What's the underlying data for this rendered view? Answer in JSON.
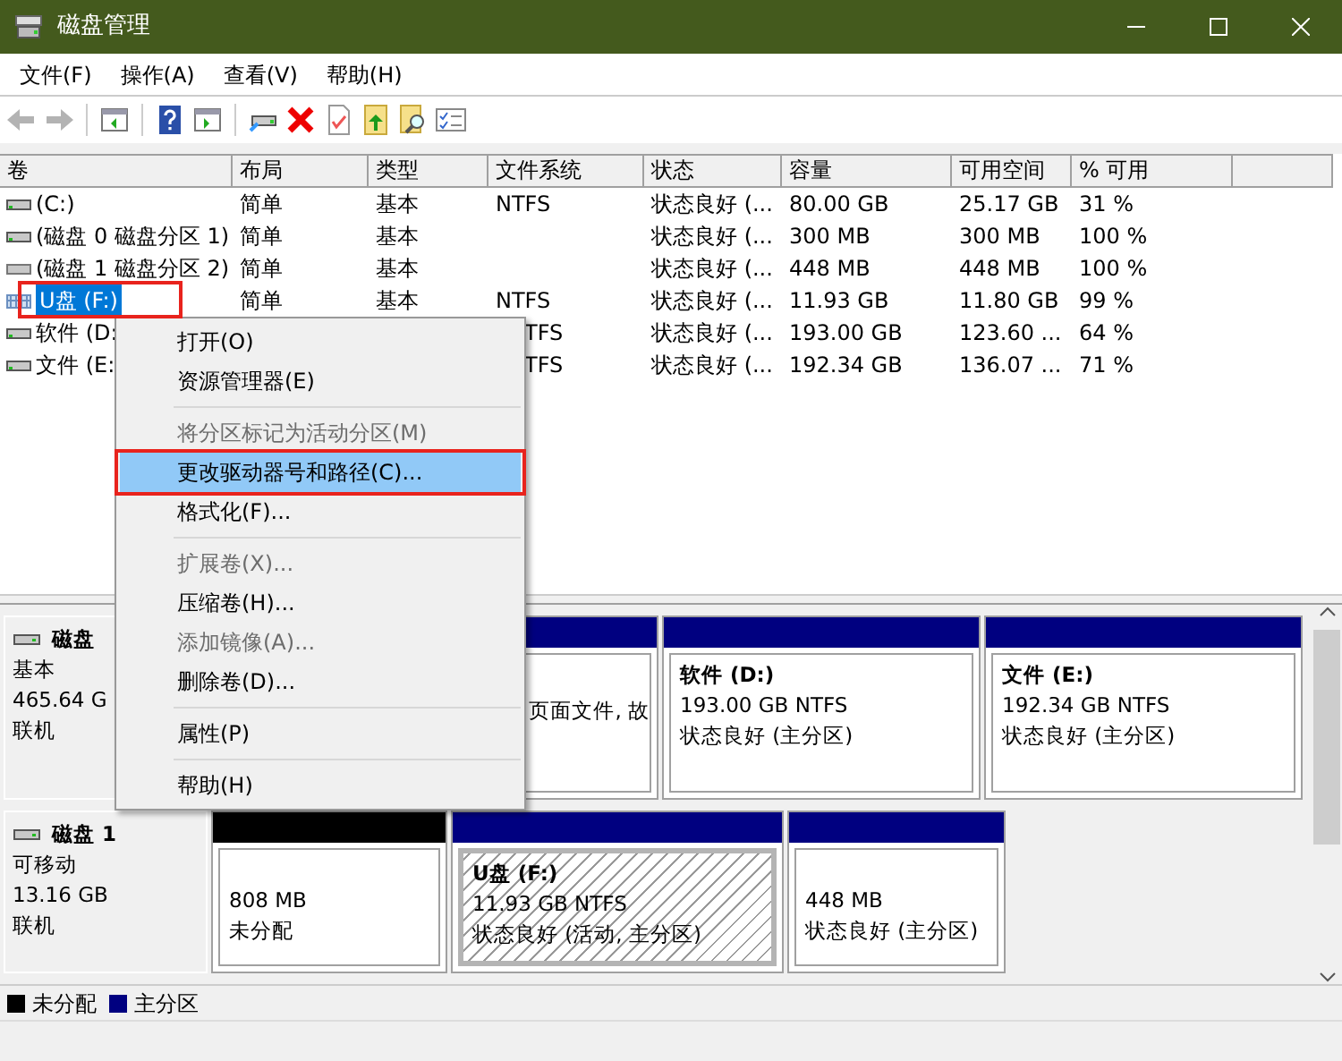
{
  "window": {
    "title": "磁盘管理"
  },
  "menu_bar": [
    "文件(F)",
    "操作(A)",
    "查看(V)",
    "帮助(H)"
  ],
  "toolbar": [
    {
      "kind": "back",
      "disabled": true
    },
    {
      "kind": "forward",
      "disabled": true
    },
    {
      "kind": "sep"
    },
    {
      "kind": "tree",
      "disabled": false
    },
    {
      "kind": "sep"
    },
    {
      "kind": "help",
      "disabled": false
    },
    {
      "kind": "pane",
      "disabled": false
    },
    {
      "kind": "sep"
    },
    {
      "kind": "connect",
      "disabled": false
    },
    {
      "kind": "delete",
      "disabled": false
    },
    {
      "kind": "check",
      "disabled": false
    },
    {
      "kind": "folder-up",
      "disabled": false
    },
    {
      "kind": "folder-search",
      "disabled": false
    },
    {
      "kind": "list",
      "disabled": false
    }
  ],
  "table": {
    "columns": [
      "卷",
      "布局",
      "类型",
      "文件系统",
      "状态",
      "容量",
      "可用空间",
      "% 可用"
    ],
    "rows": [
      {
        "kind": "drive",
        "selected": false,
        "annotated": false,
        "cells": [
          "(C:)",
          "简单",
          "基本",
          "NTFS",
          "状态良好 (...",
          "80.00 GB",
          "25.17 GB",
          "31 %"
        ]
      },
      {
        "kind": "drive",
        "selected": false,
        "annotated": false,
        "cells": [
          "(磁盘 0 磁盘分区 1)",
          "简单",
          "基本",
          "",
          "状态良好 (...",
          "300 MB",
          "300 MB",
          "100 %"
        ]
      },
      {
        "kind": "drive-plain",
        "selected": false,
        "annotated": false,
        "cells": [
          "(磁盘 1 磁盘分区 2)",
          "简单",
          "基本",
          "",
          "状态良好 (...",
          "448 MB",
          "448 MB",
          "100 %"
        ]
      },
      {
        "kind": "usb",
        "selected": true,
        "annotated": true,
        "cells": [
          "U盘 (F:)",
          "简单",
          "基本",
          "NTFS",
          "状态良好 (...",
          "11.93 GB",
          "11.80 GB",
          "99 %"
        ]
      },
      {
        "kind": "drive",
        "selected": false,
        "annotated": false,
        "covered": true,
        "cells": [
          "软件 (D:",
          "",
          "",
          "TFS",
          "状态良好 (...",
          "193.00 GB",
          "123.60 ...",
          "64 %"
        ]
      },
      {
        "kind": "drive",
        "selected": false,
        "annotated": false,
        "covered": true,
        "cells": [
          "文件 (E:",
          "",
          "",
          "TFS",
          "状态良好 (...",
          "192.34 GB",
          "136.07 ...",
          "71 %"
        ]
      }
    ]
  },
  "context_menu": [
    {
      "kind": "item",
      "label": "打开(O)",
      "disabled": false,
      "selected": false,
      "annotated": false
    },
    {
      "kind": "item",
      "label": "资源管理器(E)",
      "disabled": false,
      "selected": false,
      "annotated": false
    },
    {
      "kind": "separator"
    },
    {
      "kind": "item",
      "label": "将分区标记为活动分区(M)",
      "disabled": true,
      "selected": false,
      "annotated": false
    },
    {
      "kind": "item",
      "label": "更改驱动器号和路径(C)...",
      "disabled": false,
      "selected": true,
      "annotated": true
    },
    {
      "kind": "item",
      "label": "格式化(F)...",
      "disabled": false,
      "selected": false,
      "annotated": false
    },
    {
      "kind": "separator"
    },
    {
      "kind": "item",
      "label": "扩展卷(X)...",
      "disabled": true,
      "selected": false,
      "annotated": false
    },
    {
      "kind": "item",
      "label": "压缩卷(H)...",
      "disabled": false,
      "selected": false,
      "annotated": false
    },
    {
      "kind": "item",
      "label": "添加镜像(A)...",
      "disabled": true,
      "selected": false,
      "annotated": false
    },
    {
      "kind": "item",
      "label": "删除卷(D)...",
      "disabled": false,
      "selected": false,
      "annotated": false
    },
    {
      "kind": "separator"
    },
    {
      "kind": "item",
      "label": "属性(P)",
      "disabled": false,
      "selected": false,
      "annotated": false
    },
    {
      "kind": "separator"
    },
    {
      "kind": "item",
      "label": "帮助(H)",
      "disabled": false,
      "selected": false,
      "annotated": false
    }
  ],
  "disks": [
    {
      "name": "磁盘",
      "lines": [
        "基本",
        "465.64 G",
        "联机"
      ],
      "partitions": [
        {
          "kind": "covered",
          "color": "#000080",
          "selected": false,
          "lines": [
            "页面文件, 故"
          ]
        },
        {
          "kind": "volume",
          "color": "#000080",
          "selected": false,
          "name": "软件 (D:)",
          "lines": [
            "193.00 GB NTFS",
            "状态良好 (主分区)"
          ]
        },
        {
          "kind": "volume",
          "color": "#000080",
          "selected": false,
          "name": "文件 (E:)",
          "lines": [
            "192.34 GB NTFS",
            "状态良好 (主分区)"
          ]
        }
      ]
    },
    {
      "name": "磁盘 1",
      "lines": [
        "可移动",
        "13.16 GB",
        "联机"
      ],
      "partitions": [
        {
          "kind": "space",
          "color": "#000000",
          "selected": false,
          "lines": [
            "808 MB",
            "未分配"
          ]
        },
        {
          "kind": "volume",
          "color": "#000080",
          "selected": true,
          "name": "U盘 (F:)",
          "lines": [
            "11.93 GB NTFS",
            "状态良好 (活动, 主分区)"
          ]
        },
        {
          "kind": "space",
          "color": "#000080",
          "selected": false,
          "lines": [
            "448 MB",
            "状态良好 (主分区)"
          ]
        }
      ]
    }
  ],
  "legend": [
    {
      "label": "未分配",
      "color": "#000000"
    },
    {
      "label": "主分区",
      "color": "#000080"
    }
  ]
}
